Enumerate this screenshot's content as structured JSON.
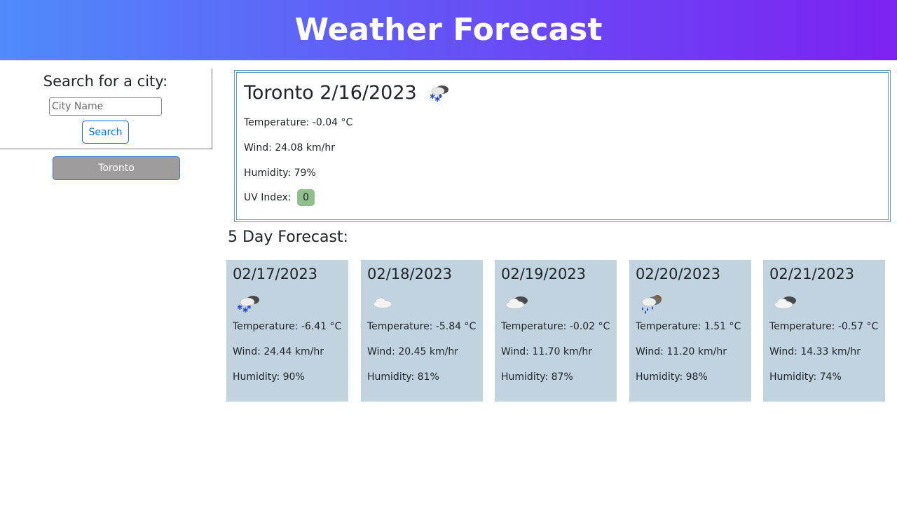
{
  "header": {
    "title": "Weather Forecast"
  },
  "search": {
    "title": "Search for a city:",
    "placeholder": "City Name",
    "value": "",
    "button_label": "Search"
  },
  "history": [
    {
      "label": "Toronto"
    }
  ],
  "current": {
    "city_date": "Toronto 2/16/2023",
    "icon": "snow-cloud-icon",
    "temperature": "Temperature: -0.04 °C",
    "wind": "Wind: 24.08 km/hr",
    "humidity": "Humidity: 79%",
    "uv_label": "UV Index:",
    "uv_value": "0",
    "uv_color": "#8fbf8a"
  },
  "forecast": {
    "title": "5 Day Forecast:",
    "card_color": "#c0d3df",
    "days": [
      {
        "date": "02/17/2023",
        "icon": "snow-cloud-icon",
        "temperature": "Temperature: -6.41 °C",
        "wind": "Wind: 24.44 km/hr",
        "humidity": "Humidity: 90%"
      },
      {
        "date": "02/18/2023",
        "icon": "cloud-icon",
        "temperature": "Temperature: -5.84 °C",
        "wind": "Wind: 20.45 km/hr",
        "humidity": "Humidity: 81%"
      },
      {
        "date": "02/19/2023",
        "icon": "broken-clouds-icon",
        "temperature": "Temperature: -0.02 °C",
        "wind": "Wind: 11.70 km/hr",
        "humidity": "Humidity: 87%"
      },
      {
        "date": "02/20/2023",
        "icon": "rain-icon",
        "temperature": "Temperature: 1.51 °C",
        "wind": "Wind: 11.20 km/hr",
        "humidity": "Humidity: 98%"
      },
      {
        "date": "02/21/2023",
        "icon": "broken-clouds-icon",
        "temperature": "Temperature: -0.57 °C",
        "wind": "Wind: 14.33 km/hr",
        "humidity": "Humidity: 74%"
      }
    ]
  }
}
